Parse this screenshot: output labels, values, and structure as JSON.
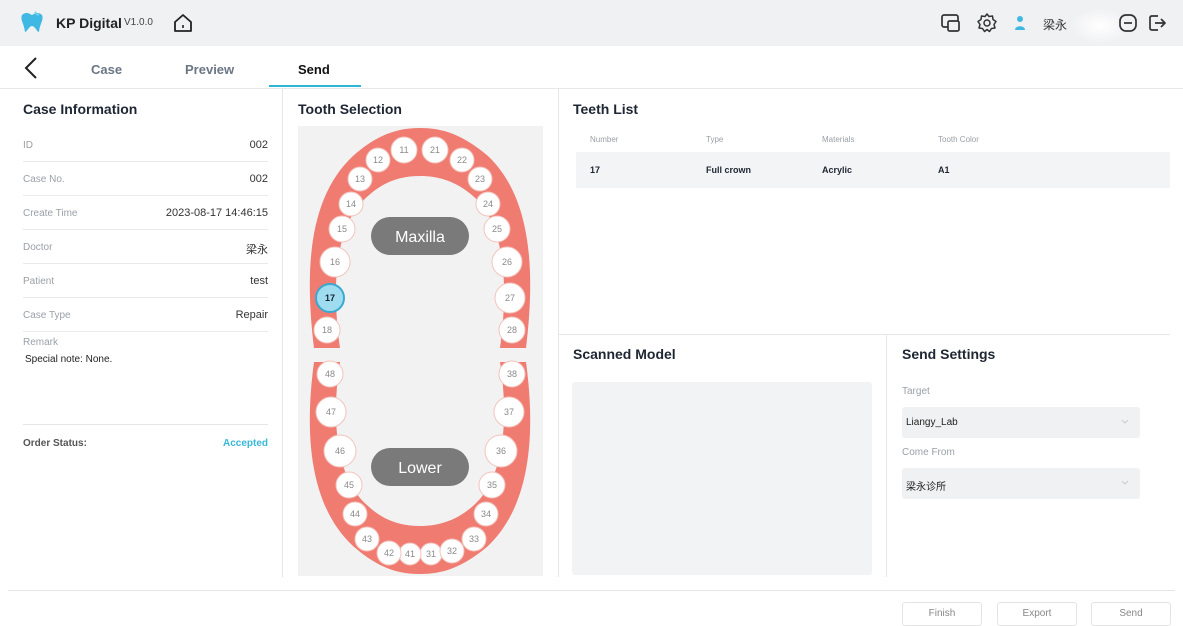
{
  "app": {
    "title": "KP Digital",
    "version": "V1.0.0",
    "accent": "#2db8d8"
  },
  "header": {
    "user_name": "梁永",
    "icons": [
      "logo-icon",
      "home-icon",
      "screen-icon",
      "settings-icon",
      "user-icon",
      "minimize-icon",
      "logout-icon"
    ]
  },
  "tabs": [
    {
      "label": "Case",
      "active": false
    },
    {
      "label": "Preview",
      "active": false
    },
    {
      "label": "Send",
      "active": true
    }
  ],
  "case_info": {
    "title": "Case Information",
    "rows": [
      {
        "label": "ID",
        "value": "002"
      },
      {
        "label": "Case No.",
        "value": "002"
      },
      {
        "label": "Create Time",
        "value": "2023-08-17 14:46:15"
      },
      {
        "label": "Doctor",
        "value": "梁永"
      },
      {
        "label": "Patient",
        "value": "test"
      },
      {
        "label": "Case Type",
        "value": "Repair"
      }
    ],
    "remark_label": "Remark",
    "remark_text": "Special note: None.",
    "order_status_label": "Order Status:",
    "order_status_value": "Accepted"
  },
  "tooth_selection": {
    "title": "Tooth Selection",
    "upper_label": "Maxilla",
    "lower_label": "Lower",
    "selected": [
      "17"
    ],
    "upper_teeth": [
      "11",
      "12",
      "13",
      "14",
      "15",
      "16",
      "17",
      "18",
      "21",
      "22",
      "23",
      "24",
      "25",
      "26",
      "27",
      "28"
    ],
    "lower_teeth": [
      "31",
      "32",
      "33",
      "34",
      "35",
      "36",
      "37",
      "38",
      "41",
      "42",
      "43",
      "44",
      "45",
      "46",
      "47",
      "48"
    ]
  },
  "teeth_list": {
    "title": "Teeth List",
    "columns": [
      "Number",
      "Type",
      "Materials",
      "Tooth Color"
    ],
    "rows": [
      [
        "17",
        "Full crown",
        "Acrylic",
        "A1"
      ]
    ]
  },
  "scanned_model": {
    "title": "Scanned Model"
  },
  "send_settings": {
    "title": "Send Settings",
    "target_label": "Target",
    "target_value": "Liangy_Lab",
    "come_from_label": "Come From",
    "come_from_value": "梁永诊所"
  },
  "footer": {
    "finish": "Finish",
    "export": "Export",
    "send": "Send"
  }
}
